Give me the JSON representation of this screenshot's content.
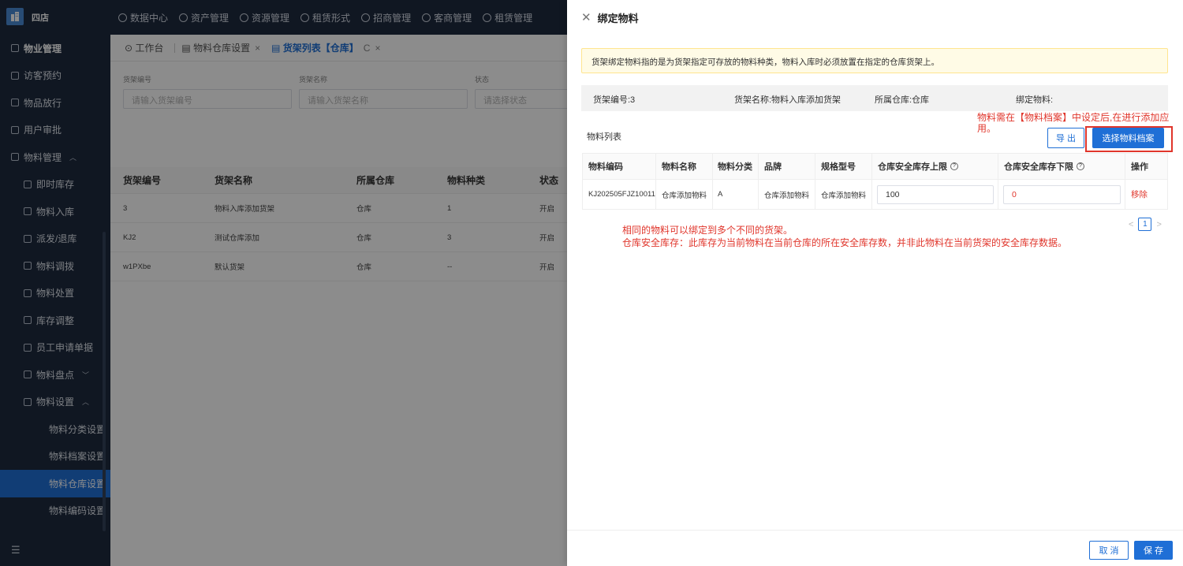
{
  "app": {
    "store_name": "四店",
    "logo_glyph": "",
    "top_nav": [
      "数据中心",
      "资产管理",
      "资源管理",
      "租赁形式",
      "招商管理",
      "客商管理",
      "租赁管理"
    ]
  },
  "sidebar": {
    "items": [
      {
        "label": "物业管理",
        "level": 0,
        "bold": true
      },
      {
        "label": "访客预约",
        "level": 0
      },
      {
        "label": "物品放行",
        "level": 0
      },
      {
        "label": "用户审批",
        "level": 0
      },
      {
        "label": "物料管理",
        "level": 0,
        "caret": "^"
      },
      {
        "label": "即时库存",
        "level": 1
      },
      {
        "label": "物料入库",
        "level": 1
      },
      {
        "label": "派发/退库",
        "level": 1
      },
      {
        "label": "物料调拨",
        "level": 1
      },
      {
        "label": "物料处置",
        "level": 1
      },
      {
        "label": "库存调整",
        "level": 1
      },
      {
        "label": "员工申请单据",
        "level": 1
      },
      {
        "label": "物料盘点",
        "level": 1,
        "caret": "v"
      },
      {
        "label": "物料设置",
        "level": 1,
        "caret": "^"
      },
      {
        "label": "物料分类设置",
        "level": 2
      },
      {
        "label": "物料档案设置",
        "level": 2
      },
      {
        "label": "物料仓库设置",
        "level": 2,
        "active": true
      },
      {
        "label": "物料编码设置",
        "level": 2
      }
    ],
    "footer_icon": "☰"
  },
  "tabs": {
    "workbench": "工作台",
    "warehouse_setting": "物料仓库设置",
    "shelf_list": "货架列表【仓库】",
    "close_glyph": "×",
    "refresh_glyph": "C"
  },
  "filter": {
    "shelf_code_label": "货架编号",
    "shelf_code_placeholder": "请输入货架编号",
    "shelf_name_label": "货架名称",
    "shelf_name_placeholder": "请输入货架名称",
    "status_label": "状态",
    "status_placeholder": "请选择状态"
  },
  "shelf_table": {
    "headers": [
      "货架编号",
      "货架名称",
      "所属仓库",
      "物料种类",
      "状态"
    ],
    "rows": [
      [
        "3",
        "物料入库添加货架",
        "仓库",
        "1",
        "开启"
      ],
      [
        "KJ2",
        "测试仓库添加",
        "仓库",
        "3",
        "开启"
      ],
      [
        "w1PXbe",
        "默认货架",
        "仓库",
        "--",
        "开启"
      ]
    ]
  },
  "drawer": {
    "close_glyph": "✕",
    "title": "绑定物料",
    "notice": "货架绑定物料指的是为货架指定可存放的物料种类，物料入库时必须放置在指定的仓库货架上。",
    "info": {
      "shelf_code": "货架编号:3",
      "shelf_name": "货架名称:物料入库添加货架",
      "warehouse": "所属仓库:仓库",
      "bound": "绑定物料:"
    },
    "annotation_top": "物料需在【物料档案】中设定后,在进行添加应用。",
    "list_title": "物料列表",
    "export_btn": "导 出",
    "select_btn": "选择物料档案",
    "table": {
      "headers": {
        "code": "物料编码",
        "name": "物料名称",
        "category": "物料分类",
        "brand": "品牌",
        "spec": "规格型号",
        "upper": "仓库安全库存上限",
        "lower": "仓库安全库存下限",
        "action": "操作"
      },
      "help_glyph": "?",
      "row": {
        "code": "KJ202505FJZ10011",
        "name": "仓库添加物料",
        "category": "A",
        "brand": "",
        "spec": "仓库添加物料",
        "spec2": "仓库添加物料",
        "upper": "100",
        "lower": "0",
        "action": "移除"
      }
    },
    "pager": {
      "prev": "<",
      "page": "1",
      "next": ">"
    },
    "note_line1": "相同的物料可以绑定到多个不同的货架。",
    "note_line2": "仓库安全库存：此库存为当前物料在当前仓库的所在安全库存数，并非此物料在当前货架的安全库存数据。",
    "cancel_btn": "取 消",
    "save_btn": "保 存"
  }
}
